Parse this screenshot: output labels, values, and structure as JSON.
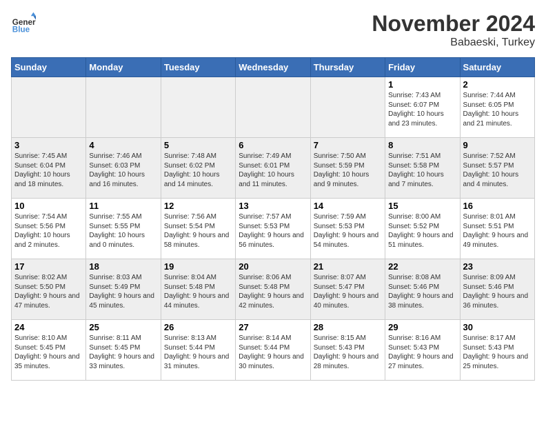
{
  "logo": {
    "line1": "General",
    "line2": "Blue"
  },
  "title": "November 2024",
  "subtitle": "Babaeski, Turkey",
  "days_of_week": [
    "Sunday",
    "Monday",
    "Tuesday",
    "Wednesday",
    "Thursday",
    "Friday",
    "Saturday"
  ],
  "weeks": [
    [
      {
        "day": "",
        "info": ""
      },
      {
        "day": "",
        "info": ""
      },
      {
        "day": "",
        "info": ""
      },
      {
        "day": "",
        "info": ""
      },
      {
        "day": "",
        "info": ""
      },
      {
        "day": "1",
        "info": "Sunrise: 7:43 AM\nSunset: 6:07 PM\nDaylight: 10 hours and 23 minutes."
      },
      {
        "day": "2",
        "info": "Sunrise: 7:44 AM\nSunset: 6:05 PM\nDaylight: 10 hours and 21 minutes."
      }
    ],
    [
      {
        "day": "3",
        "info": "Sunrise: 7:45 AM\nSunset: 6:04 PM\nDaylight: 10 hours and 18 minutes."
      },
      {
        "day": "4",
        "info": "Sunrise: 7:46 AM\nSunset: 6:03 PM\nDaylight: 10 hours and 16 minutes."
      },
      {
        "day": "5",
        "info": "Sunrise: 7:48 AM\nSunset: 6:02 PM\nDaylight: 10 hours and 14 minutes."
      },
      {
        "day": "6",
        "info": "Sunrise: 7:49 AM\nSunset: 6:01 PM\nDaylight: 10 hours and 11 minutes."
      },
      {
        "day": "7",
        "info": "Sunrise: 7:50 AM\nSunset: 5:59 PM\nDaylight: 10 hours and 9 minutes."
      },
      {
        "day": "8",
        "info": "Sunrise: 7:51 AM\nSunset: 5:58 PM\nDaylight: 10 hours and 7 minutes."
      },
      {
        "day": "9",
        "info": "Sunrise: 7:52 AM\nSunset: 5:57 PM\nDaylight: 10 hours and 4 minutes."
      }
    ],
    [
      {
        "day": "10",
        "info": "Sunrise: 7:54 AM\nSunset: 5:56 PM\nDaylight: 10 hours and 2 minutes."
      },
      {
        "day": "11",
        "info": "Sunrise: 7:55 AM\nSunset: 5:55 PM\nDaylight: 10 hours and 0 minutes."
      },
      {
        "day": "12",
        "info": "Sunrise: 7:56 AM\nSunset: 5:54 PM\nDaylight: 9 hours and 58 minutes."
      },
      {
        "day": "13",
        "info": "Sunrise: 7:57 AM\nSunset: 5:53 PM\nDaylight: 9 hours and 56 minutes."
      },
      {
        "day": "14",
        "info": "Sunrise: 7:59 AM\nSunset: 5:53 PM\nDaylight: 9 hours and 54 minutes."
      },
      {
        "day": "15",
        "info": "Sunrise: 8:00 AM\nSunset: 5:52 PM\nDaylight: 9 hours and 51 minutes."
      },
      {
        "day": "16",
        "info": "Sunrise: 8:01 AM\nSunset: 5:51 PM\nDaylight: 9 hours and 49 minutes."
      }
    ],
    [
      {
        "day": "17",
        "info": "Sunrise: 8:02 AM\nSunset: 5:50 PM\nDaylight: 9 hours and 47 minutes."
      },
      {
        "day": "18",
        "info": "Sunrise: 8:03 AM\nSunset: 5:49 PM\nDaylight: 9 hours and 45 minutes."
      },
      {
        "day": "19",
        "info": "Sunrise: 8:04 AM\nSunset: 5:48 PM\nDaylight: 9 hours and 44 minutes."
      },
      {
        "day": "20",
        "info": "Sunrise: 8:06 AM\nSunset: 5:48 PM\nDaylight: 9 hours and 42 minutes."
      },
      {
        "day": "21",
        "info": "Sunrise: 8:07 AM\nSunset: 5:47 PM\nDaylight: 9 hours and 40 minutes."
      },
      {
        "day": "22",
        "info": "Sunrise: 8:08 AM\nSunset: 5:46 PM\nDaylight: 9 hours and 38 minutes."
      },
      {
        "day": "23",
        "info": "Sunrise: 8:09 AM\nSunset: 5:46 PM\nDaylight: 9 hours and 36 minutes."
      }
    ],
    [
      {
        "day": "24",
        "info": "Sunrise: 8:10 AM\nSunset: 5:45 PM\nDaylight: 9 hours and 35 minutes."
      },
      {
        "day": "25",
        "info": "Sunrise: 8:11 AM\nSunset: 5:45 PM\nDaylight: 9 hours and 33 minutes."
      },
      {
        "day": "26",
        "info": "Sunrise: 8:13 AM\nSunset: 5:44 PM\nDaylight: 9 hours and 31 minutes."
      },
      {
        "day": "27",
        "info": "Sunrise: 8:14 AM\nSunset: 5:44 PM\nDaylight: 9 hours and 30 minutes."
      },
      {
        "day": "28",
        "info": "Sunrise: 8:15 AM\nSunset: 5:43 PM\nDaylight: 9 hours and 28 minutes."
      },
      {
        "day": "29",
        "info": "Sunrise: 8:16 AM\nSunset: 5:43 PM\nDaylight: 9 hours and 27 minutes."
      },
      {
        "day": "30",
        "info": "Sunrise: 8:17 AM\nSunset: 5:43 PM\nDaylight: 9 hours and 25 minutes."
      }
    ]
  ]
}
